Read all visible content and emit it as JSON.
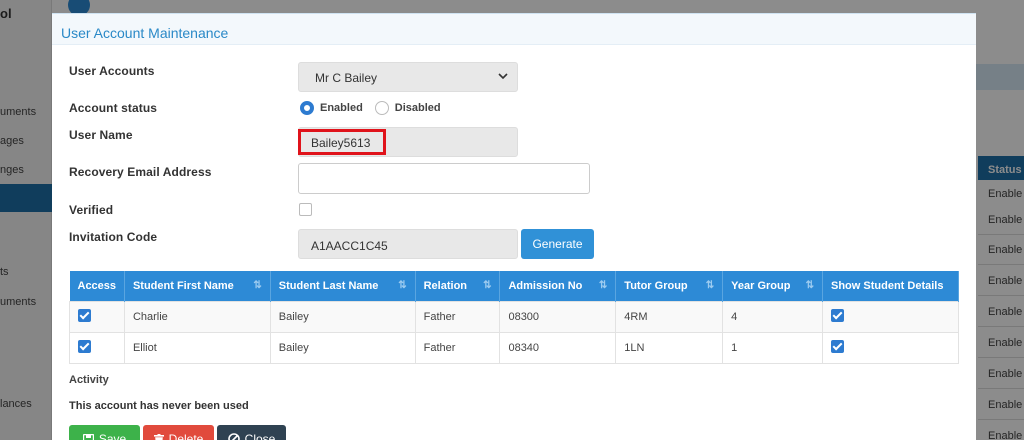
{
  "background": {
    "brand_fragment": "ol",
    "nav_items": [
      "uments",
      "ages",
      "nges",
      "ts",
      "uments",
      "lances"
    ],
    "table_header": "Status",
    "table_cells": [
      "Enable",
      "Enable",
      "Enable",
      "Enable",
      "Enable",
      "Enable",
      "Enable",
      "Enable",
      "Enable",
      "Enable"
    ]
  },
  "modal": {
    "title": "User Account Maintenance",
    "labels": {
      "user_accounts": "User Accounts",
      "account_status": "Account status",
      "user_name": "User Name",
      "recovery_email": "Recovery Email Address",
      "verified": "Verified",
      "invitation_code": "Invitation Code"
    },
    "user_accounts_selected": "Mr C Bailey",
    "status_options": {
      "enabled": "Enabled",
      "disabled": "Disabled"
    },
    "status_selected": "Enabled",
    "user_name_value": "Bailey5613",
    "recovery_email_value": "",
    "verified_checked": false,
    "invitation_code_value": "A1AACC1C45",
    "generate_label": "Generate",
    "table": {
      "headers": [
        "Access",
        "Student First Name",
        "Student Last Name",
        "Relation",
        "Admission No",
        "Tutor Group",
        "Year Group",
        "Show Student Details"
      ],
      "rows": [
        {
          "access": true,
          "first": "Charlie",
          "last": "Bailey",
          "relation": "Father",
          "admission": "08300",
          "tutor": "4RM",
          "year": "4",
          "show": true
        },
        {
          "access": true,
          "first": "Elliot",
          "last": "Bailey",
          "relation": "Father",
          "admission": "08340",
          "tutor": "1LN",
          "year": "1",
          "show": true
        }
      ]
    },
    "activity_label": "Activity",
    "activity_text": "This account has never been used",
    "buttons": {
      "save": "Save",
      "delete": "Delete",
      "close": "Close"
    }
  },
  "colors": {
    "accent": "#2d8ad6",
    "highlight": "#e0131b",
    "save": "#3db24a",
    "delete": "#e14a3c",
    "close": "#2f4252"
  }
}
